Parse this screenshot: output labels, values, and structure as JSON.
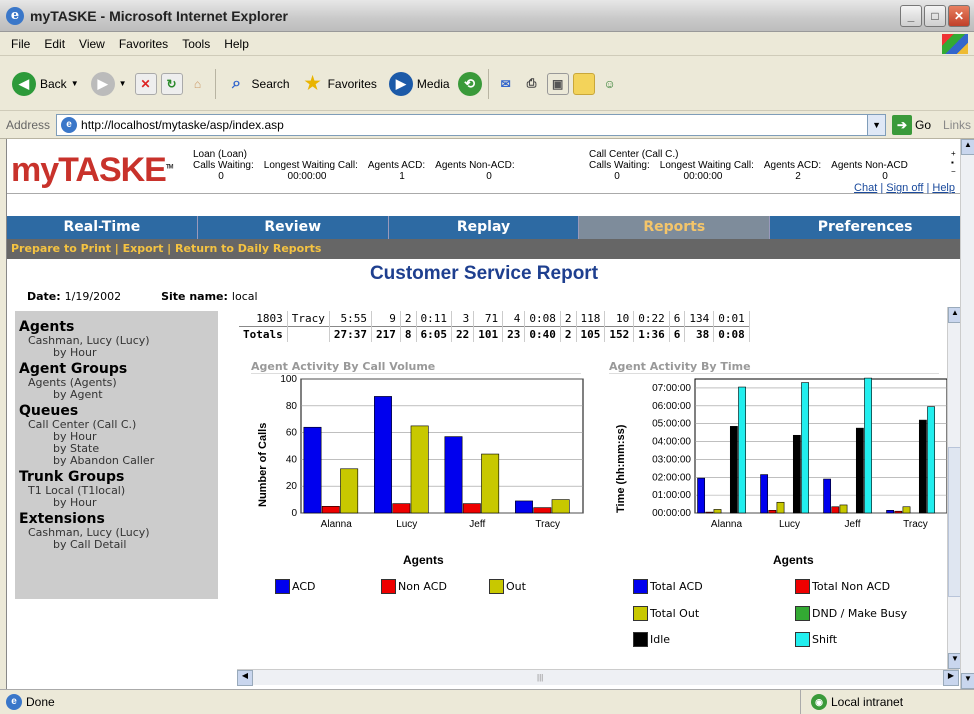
{
  "window": {
    "title": "myTASKE - Microsoft Internet Explorer"
  },
  "menu": [
    "File",
    "Edit",
    "View",
    "Favorites",
    "Tools",
    "Help"
  ],
  "toolbar": {
    "back": "Back",
    "search": "Search",
    "favorites": "Favorites",
    "media": "Media"
  },
  "address": {
    "label": "Address",
    "url": "http://localhost/mytaske/asp/index.asp",
    "go": "Go",
    "links": "Links"
  },
  "brand": {
    "my": "my",
    "taske": "TASKE",
    "tm": "TM"
  },
  "queues": [
    {
      "name": "Loan (Loan)",
      "calls_waiting_label": "Calls Waiting:",
      "calls_waiting": "0",
      "longest_label": "Longest Waiting Call:",
      "longest": "00:00:00",
      "acd_label": "Agents ACD:",
      "acd": "1",
      "nonacd_label": "Agents Non-ACD:",
      "nonacd": "0"
    },
    {
      "name": "Call Center (Call C.)",
      "calls_waiting_label": "Calls Waiting:",
      "calls_waiting": "0",
      "longest_label": "Longest Waiting Call:",
      "longest": "00:00:00",
      "acd_label": "Agents ACD:",
      "acd": "2",
      "nonacd_label": "Agents Non-ACD",
      "nonacd": "0"
    }
  ],
  "header_links": {
    "chat": "Chat",
    "signoff": "Sign off",
    "help": "Help",
    "sep": "|"
  },
  "nav": [
    "Real-Time",
    "Review",
    "Replay",
    "Reports",
    "Preferences"
  ],
  "subnav": "Prepare to Print |  Export | Return to Daily Reports",
  "report": {
    "title": "Customer Service Report",
    "date_label": "Date:",
    "date": "1/19/2002",
    "site_label": "Site name:",
    "site": "local"
  },
  "sidebar": {
    "agents": {
      "title": "Agents",
      "item": "Cashman, Lucy (Lucy)",
      "sub": "by Hour"
    },
    "agent_groups": {
      "title": "Agent Groups",
      "item": "Agents (Agents)",
      "sub": "by Agent"
    },
    "queues": {
      "title": "Queues",
      "item": "Call Center (Call C.)",
      "subs": [
        "by Hour",
        "by State",
        "by Abandon Caller"
      ]
    },
    "trunk_groups": {
      "title": "Trunk Groups",
      "item": "T1 Local (T1local)",
      "sub": "by Hour"
    },
    "extensions": {
      "title": "Extensions",
      "item": "Cashman, Lucy (Lucy)",
      "sub": "by Call Detail"
    }
  },
  "table": {
    "row": [
      "1803",
      "Tracy",
      "5:55",
      "9",
      "2",
      "0:11",
      "3",
      "71",
      "4",
      "0:08",
      "2",
      "118",
      "10",
      "0:22",
      "6",
      "134",
      "0:01"
    ],
    "totals": [
      "Totals",
      "",
      "27:37",
      "217",
      "8",
      "6:05",
      "22",
      "101",
      "23",
      "0:40",
      "2",
      "105",
      "152",
      "1:36",
      "6",
      "38",
      "0:08"
    ]
  },
  "status": {
    "left": "Done",
    "zone": "Local intranet"
  },
  "chart_data": [
    {
      "type": "bar",
      "title": "Agent Activity By Call Volume",
      "xlabel": "Agents",
      "ylabel": "Number of Calls",
      "categories": [
        "Alanna",
        "Lucy",
        "Jeff",
        "Tracy"
      ],
      "ylim": [
        0,
        100
      ],
      "yticks": [
        "0",
        "20",
        "40",
        "60",
        "80",
        "100"
      ],
      "series": [
        {
          "name": "ACD",
          "color": "#0000ee",
          "values": [
            64,
            87,
            57,
            9
          ]
        },
        {
          "name": "Non ACD",
          "color": "#ee0000",
          "values": [
            5,
            7,
            7,
            4
          ]
        },
        {
          "name": "Out",
          "color": "#c8c800",
          "values": [
            33,
            65,
            44,
            10
          ]
        }
      ]
    },
    {
      "type": "bar",
      "title": "Agent Activity By Time",
      "xlabel": "Agents",
      "ylabel": "Time (hh:mm:ss)",
      "categories": [
        "Alanna",
        "Lucy",
        "Jeff",
        "Tracy"
      ],
      "ylim": [
        0,
        7.5
      ],
      "yticks": [
        "00:00:00",
        "01:00:00",
        "02:00:00",
        "03:00:00",
        "04:00:00",
        "05:00:00",
        "06:00:00",
        "07:00:00"
      ],
      "series": [
        {
          "name": "Total ACD",
          "color": "#0000ee",
          "values": [
            1.95,
            2.15,
            1.9,
            0.15
          ]
        },
        {
          "name": "Total Non ACD",
          "color": "#ee0000",
          "values": [
            0.05,
            0.15,
            0.35,
            0.1
          ]
        },
        {
          "name": "Total Out",
          "color": "#c8c800",
          "values": [
            0.2,
            0.6,
            0.45,
            0.35
          ]
        },
        {
          "name": "DND / Make Busy",
          "color": "#33aa33",
          "values": [
            0,
            0,
            0,
            0
          ]
        },
        {
          "name": "Idle",
          "color": "#000000",
          "values": [
            4.85,
            4.35,
            4.75,
            5.2
          ]
        },
        {
          "name": "Shift",
          "color": "#22eeee",
          "values": [
            7.05,
            7.3,
            7.55,
            5.95
          ]
        }
      ]
    }
  ]
}
